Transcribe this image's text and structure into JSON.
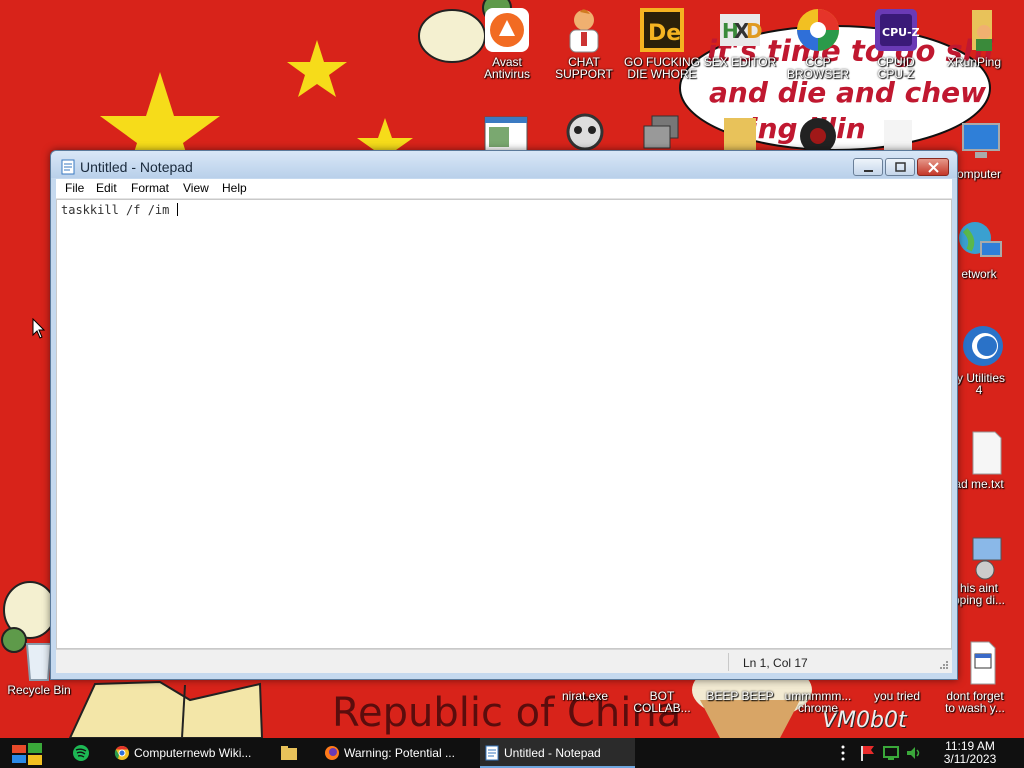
{
  "wallpaper": {
    "banner_line1": "it's time to go shi",
    "banner_line2": "and die and chew",
    "banner_line3": "ing illin",
    "bottom_text": "Republic of China",
    "signature": "VM0b0t",
    "colors": {
      "background": "#d8231a",
      "star": "#f6dc1a"
    }
  },
  "desktop_icons": [
    {
      "id": "avast",
      "label": "Avast\nAntivirus",
      "icon": "avast-icon"
    },
    {
      "id": "chat-support",
      "label": "CHAT\nSUPPORT",
      "icon": "support-agent-icon"
    },
    {
      "id": "go-die",
      "label": "GO FUCKING\nDIE WHORE",
      "icon": "de-icon"
    },
    {
      "id": "hxd",
      "label": "SEX EDITOR",
      "icon": "hxd-hex-editor-icon"
    },
    {
      "id": "ccp-browser",
      "label": "CCP\nBROWSER",
      "icon": "colorful-browser-icon"
    },
    {
      "id": "cpuz",
      "label": "CPUID\nCPU-Z",
      "icon": "cpuz-icon"
    },
    {
      "id": "xrunping",
      "label": "XRunPing",
      "icon": "folder-user-icon"
    },
    {
      "id": "computer",
      "label": "omputer",
      "icon": "computer-monitor-icon"
    },
    {
      "id": "network",
      "label": "etwork",
      "icon": "network-globe-icon"
    },
    {
      "id": "glary",
      "label": "ry Utilities\n4",
      "icon": "glary-utilities-icon"
    },
    {
      "id": "readme",
      "label": "ad me.txt",
      "icon": "text-file-icon"
    },
    {
      "id": "this-aint",
      "label": "his aint\npping di...",
      "icon": "computer-disc-icon"
    },
    {
      "id": "recycle-bin",
      "label": "Recycle Bin",
      "icon": "recycle-bin-icon"
    },
    {
      "id": "nirat",
      "label": "nirat.exe",
      "icon": "exe-icon"
    },
    {
      "id": "bot-collab",
      "label": "BOT\nCOLLAB...",
      "icon": "bot-icon"
    },
    {
      "id": "beep-beep",
      "label": "BEEP BEEP",
      "icon": "beep-icon"
    },
    {
      "id": "ummm-chrome",
      "label": "ummmmm...\nchrome",
      "icon": "chrome-shortcut-icon"
    },
    {
      "id": "you-tried",
      "label": "you tried",
      "icon": "you-tried-icon"
    },
    {
      "id": "dont-forget",
      "label": "dont forget\nto wash y...",
      "icon": "calendar-file-icon"
    }
  ],
  "notepad": {
    "title": "Untitled - Notepad",
    "menu": [
      "File",
      "Edit",
      "Format",
      "View",
      "Help"
    ],
    "content": "taskkill /f /im ",
    "status_position": "Ln 1, Col 17"
  },
  "taskbar": {
    "tasks": [
      {
        "label": "Computernewb Wiki...",
        "icon": "chrome-icon"
      },
      {
        "label": "Warning: Potential ...",
        "icon": "firefox-icon"
      },
      {
        "label": "Untitled - Notepad",
        "icon": "notepad-icon",
        "active": true
      }
    ],
    "clock_time": "11:19 AM",
    "clock_date": "3/11/2023"
  }
}
